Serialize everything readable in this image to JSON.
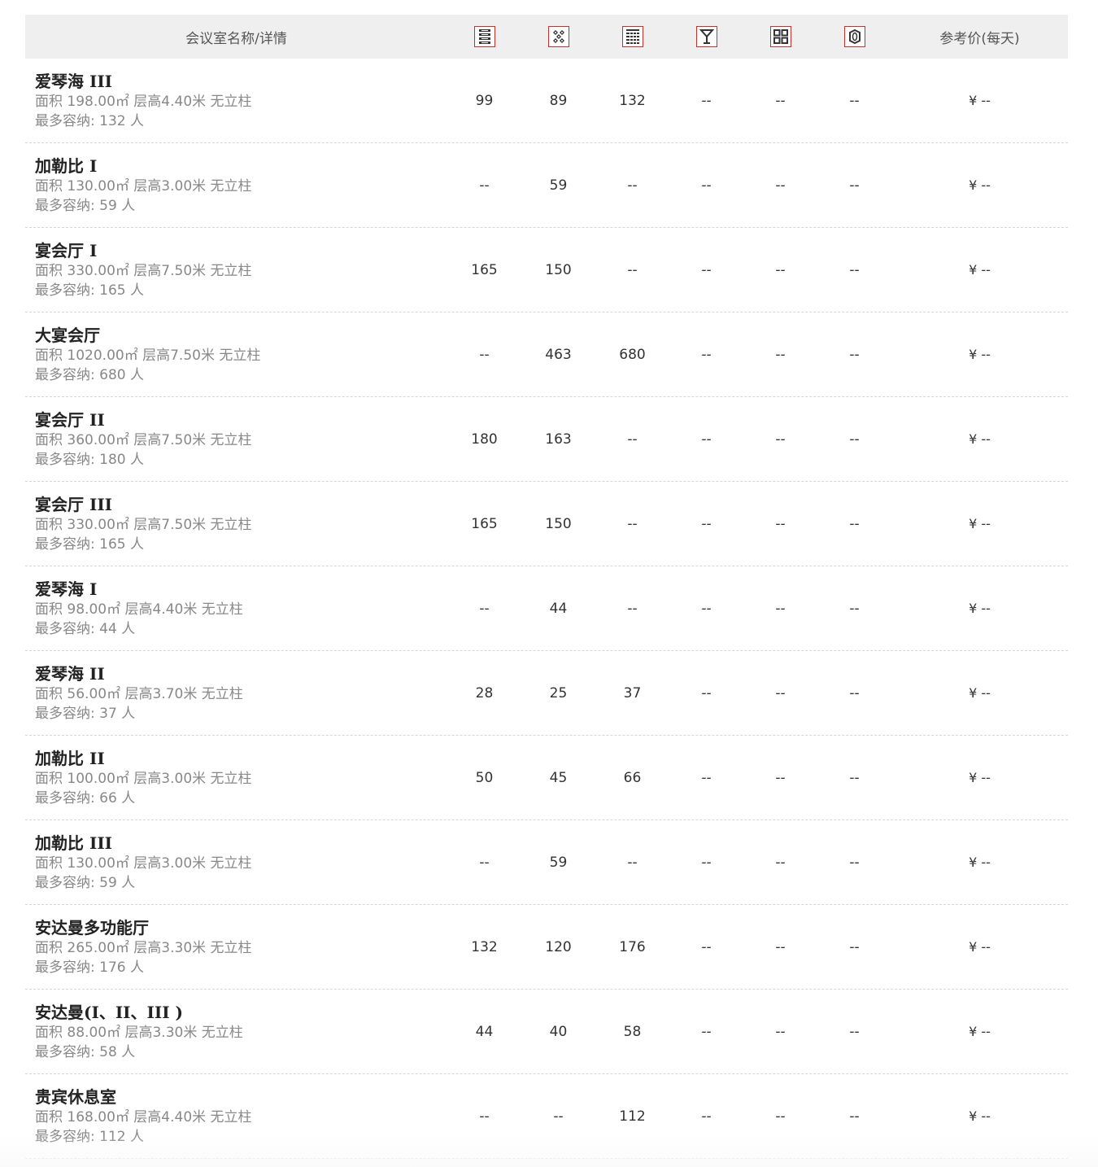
{
  "header": {
    "name_col": "会议室名称/详情",
    "price_col": "参考价(每天)",
    "icons": [
      "theater-layout-icon",
      "banquet-layout-icon",
      "classroom-layout-icon",
      "cocktail-layout-icon",
      "ushape-layout-icon",
      "boardroom-layout-icon"
    ]
  },
  "accent_color": "#c9302c",
  "rooms": [
    {
      "name": "爱琴海 III",
      "detail": "面积 198.00㎡ 层高4.40米 无立柱",
      "cap": "最多容纳: 132 人",
      "v1": "99",
      "v2": "89",
      "v3": "132",
      "v4": "--",
      "v5": "--",
      "v6": "--",
      "price": "¥ --"
    },
    {
      "name": "加勒比 I",
      "detail": "面积 130.00㎡ 层高3.00米 无立柱",
      "cap": "最多容纳: 59 人",
      "v1": "--",
      "v2": "59",
      "v3": "--",
      "v4": "--",
      "v5": "--",
      "v6": "--",
      "price": "¥ --"
    },
    {
      "name": "宴会厅 I",
      "detail": "面积 330.00㎡ 层高7.50米 无立柱",
      "cap": "最多容纳: 165 人",
      "v1": "165",
      "v2": "150",
      "v3": "--",
      "v4": "--",
      "v5": "--",
      "v6": "--",
      "price": "¥ --"
    },
    {
      "name": "大宴会厅",
      "detail": "面积 1020.00㎡ 层高7.50米 无立柱",
      "cap": "最多容纳: 680 人",
      "v1": "--",
      "v2": "463",
      "v3": "680",
      "v4": "--",
      "v5": "--",
      "v6": "--",
      "price": "¥ --"
    },
    {
      "name": "宴会厅 II",
      "detail": "面积 360.00㎡ 层高7.50米 无立柱",
      "cap": "最多容纳: 180 人",
      "v1": "180",
      "v2": "163",
      "v3": "--",
      "v4": "--",
      "v5": "--",
      "v6": "--",
      "price": "¥ --"
    },
    {
      "name": "宴会厅 III",
      "detail": "面积 330.00㎡ 层高7.50米 无立柱",
      "cap": "最多容纳: 165 人",
      "v1": "165",
      "v2": "150",
      "v3": "--",
      "v4": "--",
      "v5": "--",
      "v6": "--",
      "price": "¥ --"
    },
    {
      "name": "爱琴海 I",
      "detail": "面积 98.00㎡ 层高4.40米 无立柱",
      "cap": "最多容纳: 44 人",
      "v1": "--",
      "v2": "44",
      "v3": "--",
      "v4": "--",
      "v5": "--",
      "v6": "--",
      "price": "¥ --"
    },
    {
      "name": "爱琴海 II",
      "detail": "面积 56.00㎡ 层高3.70米 无立柱",
      "cap": "最多容纳: 37 人",
      "v1": "28",
      "v2": "25",
      "v3": "37",
      "v4": "--",
      "v5": "--",
      "v6": "--",
      "price": "¥ --"
    },
    {
      "name": "加勒比 II",
      "detail": "面积 100.00㎡ 层高3.00米 无立柱",
      "cap": "最多容纳: 66 人",
      "v1": "50",
      "v2": "45",
      "v3": "66",
      "v4": "--",
      "v5": "--",
      "v6": "--",
      "price": "¥ --"
    },
    {
      "name": "加勒比 III",
      "detail": "面积 130.00㎡ 层高3.00米 无立柱",
      "cap": "最多容纳: 59 人",
      "v1": "--",
      "v2": "59",
      "v3": "--",
      "v4": "--",
      "v5": "--",
      "v6": "--",
      "price": "¥ --"
    },
    {
      "name": "安达曼多功能厅",
      "detail": "面积 265.00㎡ 层高3.30米 无立柱",
      "cap": "最多容纳: 176 人",
      "v1": "132",
      "v2": "120",
      "v3": "176",
      "v4": "--",
      "v5": "--",
      "v6": "--",
      "price": "¥ --"
    },
    {
      "name": "安达曼(I、II、III )",
      "detail": "面积 88.00㎡ 层高3.30米 无立柱",
      "cap": "最多容纳: 58 人",
      "v1": "44",
      "v2": "40",
      "v3": "58",
      "v4": "--",
      "v5": "--",
      "v6": "--",
      "price": "¥ --"
    },
    {
      "name": "贵宾休息室",
      "detail": "面积 168.00㎡ 层高4.40米 无立柱",
      "cap": "最多容纳: 112 人",
      "v1": "--",
      "v2": "--",
      "v3": "112",
      "v4": "--",
      "v5": "--",
      "v6": "--",
      "price": "¥ --"
    }
  ]
}
